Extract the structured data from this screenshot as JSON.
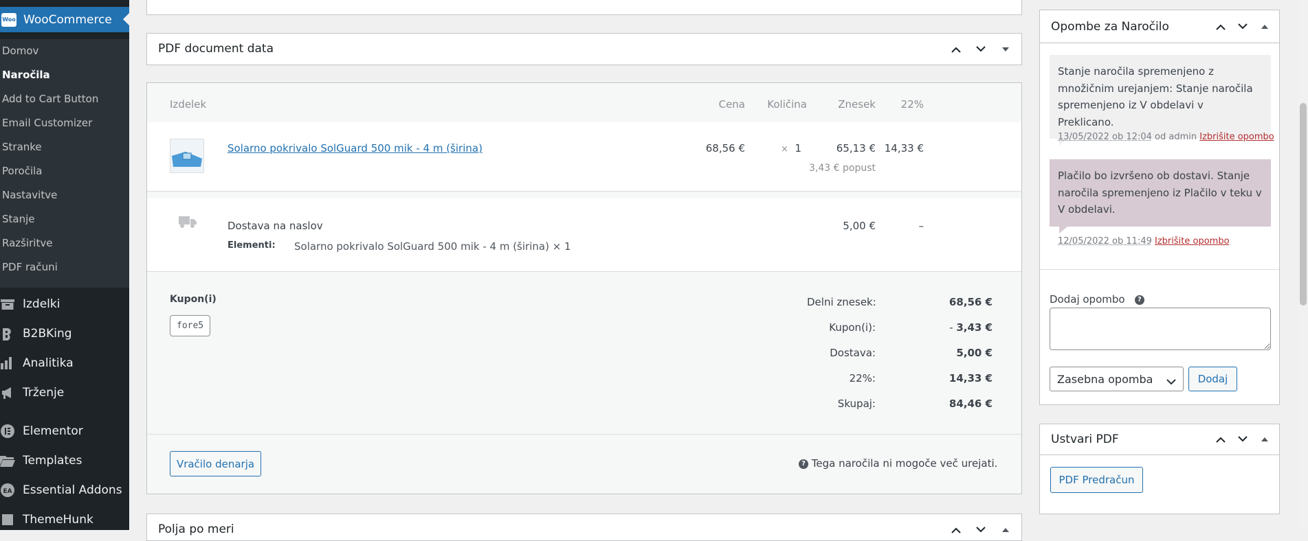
{
  "sidebar": {
    "brand": {
      "logo_text": "Woo",
      "title": "WooCommerce"
    },
    "submenu": [
      {
        "label": "Domov",
        "current": false
      },
      {
        "label": "Naročila",
        "current": true
      },
      {
        "label": "Add to Cart Button",
        "current": false
      },
      {
        "label": "Email Customizer",
        "current": false
      },
      {
        "label": "Stranke",
        "current": false
      },
      {
        "label": "Poročila",
        "current": false
      },
      {
        "label": "Nastavitve",
        "current": false
      },
      {
        "label": "Stanje",
        "current": false
      },
      {
        "label": "Razširitve",
        "current": false
      },
      {
        "label": "PDF računi",
        "current": false
      }
    ],
    "menu": [
      {
        "label": "Izdelki",
        "icon": "archive-icon"
      },
      {
        "label": "B2BKing",
        "icon": "b2bking-icon"
      },
      {
        "label": "Analitika",
        "icon": "bar-chart-icon"
      },
      {
        "label": "Trženje",
        "icon": "megaphone-icon"
      },
      {
        "label": "Elementor",
        "icon": "elementor-icon"
      },
      {
        "label": "Templates",
        "icon": "folder-icon"
      },
      {
        "label": "Essential Addons",
        "icon": "ea-icon"
      },
      {
        "label": "ThemeHunk",
        "icon": "themehunk-icon"
      }
    ]
  },
  "pdf_box": {
    "title": "PDF document data"
  },
  "order_items": {
    "headers": {
      "item": "Izdelek",
      "cost": "Cena",
      "qty": "Količina",
      "total": "Znesek",
      "tax": "22%"
    },
    "product": {
      "name": "Solarno pokrivalo SolGuard 500 mik - 4 m (širina)",
      "cost": "68,56 €",
      "qty_x": "×",
      "qty": "1",
      "total": "65,13 €",
      "discount": "3,43 € popust",
      "tax": "14,33 €"
    },
    "shipping": {
      "name": "Dostava na naslov",
      "items_label": "Elementi:",
      "items_value": "Solarno pokrivalo SolGuard 500 mik - 4 m (širina) × 1",
      "total": "5,00 €",
      "tax": "–"
    },
    "coupons": {
      "label": "Kupon(i)",
      "code": "fore5"
    },
    "totals": [
      {
        "label": "Delni znesek:",
        "value": "68,56 €"
      },
      {
        "label": "Kupon(i):",
        "value": "3,43 €"
      },
      {
        "label": "Dostava:",
        "value": "5,00 €"
      },
      {
        "label": "22%:",
        "value": "14,33 €"
      },
      {
        "label": "Skupaj:",
        "value": "84,46 €"
      }
    ],
    "coupon_prefix": "-",
    "refund_button": "Vračilo denarja",
    "not_editable": "Tega naročila ni mogoče več urejati."
  },
  "custom_fields": {
    "title": "Polja po meri"
  },
  "notes": {
    "title": "Opombe za Naročilo",
    "items": [
      {
        "text": "Stanje naročila spremenjeno z množičnim urejanjem: Stanje naročila spremenjeno iz V obdelavi v Preklicano.",
        "date": "13/05/2022 ob 12:04",
        "by": "od admin",
        "delete": "Izbrišite opombo",
        "style": "gray"
      },
      {
        "text": "Plačilo bo izvršeno ob dostavi. Stanje naročila spremenjeno iz Plačilo v teku v V obdelavi.",
        "date": "12/05/2022 ob 11:49",
        "by": "",
        "delete": "Izbrišite opombo",
        "style": "purple"
      }
    ],
    "add_label": "Dodaj opombo",
    "help_glyph": "?",
    "note_type_selected": "Zasebna opomba",
    "add_button": "Dodaj"
  },
  "create_pdf": {
    "title": "Ustvari PDF",
    "button": "PDF Predračun"
  },
  "colors": {
    "sidebar": "#1d2327",
    "submenu": "#2c3338",
    "accent": "#2271b1",
    "delete": "#b32d2e",
    "note_gray": "#f0f0f1",
    "note_purple": "#d7cad2"
  }
}
